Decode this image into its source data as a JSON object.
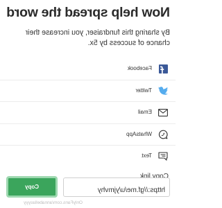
{
  "header": {
    "title": "Now help spread the word",
    "description": "By sharing this fundraiser, you increase their chance of success by 5x."
  },
  "share_options": [
    {
      "label": "Facebook",
      "icon": "facebook-icon"
    },
    {
      "label": "Twitter",
      "icon": "twitter-icon"
    },
    {
      "label": "Email",
      "icon": "email-icon"
    },
    {
      "label": "WhatsApp",
      "icon": "whatsapp-icon"
    },
    {
      "label": "Text",
      "icon": "text-message-icon"
    }
  ],
  "copy_link": {
    "label": "Copy link",
    "value": "https://gf.me/u/yjmvhy",
    "button_label": "Copy"
  },
  "watermark": "OnlyFans.com/annabellasyyy",
  "colors": {
    "facebook": "#3b5998",
    "twitter": "#55acee",
    "copy_button": "#3ba55c"
  }
}
